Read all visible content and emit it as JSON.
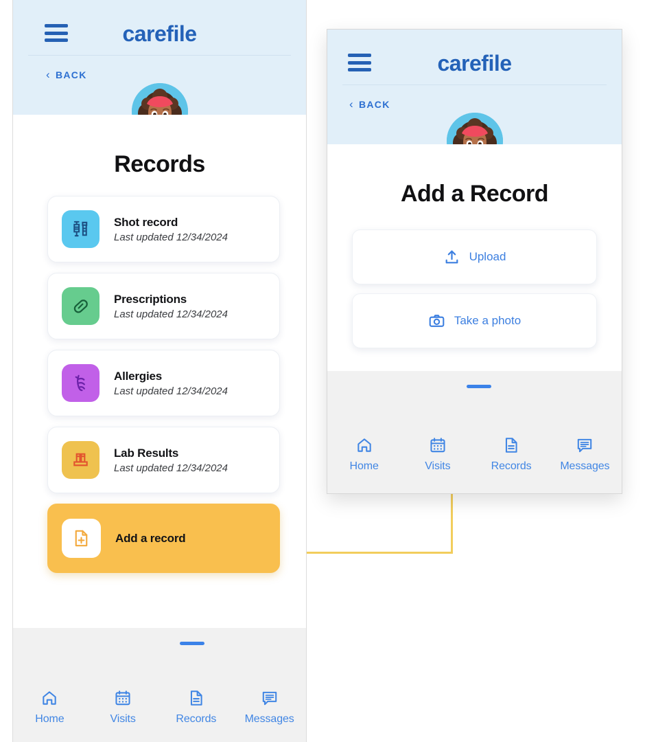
{
  "brand": {
    "name": "carefile"
  },
  "colors": {
    "brand_blue": "#2462b8",
    "header_bg": "#e1eff9",
    "nav_blue": "#4186e4",
    "highlight_yellow": "#f9bf4e",
    "connector_yellow": "#f2cd5c",
    "avatar_circle": "#5ec4e8",
    "badge_green": "#21c24a"
  },
  "screen_records": {
    "menu_icon": "hamburger-menu-icon",
    "back_label": "BACK",
    "back_icon": "chevron-left-icon",
    "avatar": "user-avatar",
    "avatar_badge_icon": "edit-pencil-icon",
    "title": "Records",
    "items": [
      {
        "title": "Shot record",
        "subtitle": "Last updated 12/34/2024",
        "icon": "syringe-icon",
        "tile_color": "#5ac8ef",
        "icon_color": "#1c4f82"
      },
      {
        "title": "Prescriptions",
        "subtitle": "Last updated 12/34/2024",
        "icon": "pill-icon",
        "tile_color": "#66cc8e",
        "icon_color": "#17603a"
      },
      {
        "title": "Allergies",
        "subtitle": "Last updated 12/34/2024",
        "icon": "allergen-icon",
        "tile_color": "#c160e8",
        "icon_color": "#6b21a8"
      },
      {
        "title": "Lab Results",
        "subtitle": "Last updated 12/34/2024",
        "icon": "test-tubes-icon",
        "tile_color": "#efc martial",
        "icon_color": "#e2552f"
      }
    ],
    "add_item": {
      "title": "Add a record",
      "icon": "add-document-icon",
      "tile_color": "#ffffff",
      "icon_color": "#f3a93c"
    },
    "nav": [
      {
        "label": "Home",
        "icon": "home-icon",
        "active": false
      },
      {
        "label": "Visits",
        "icon": "calendar-icon",
        "active": false
      },
      {
        "label": "Records",
        "icon": "document-icon",
        "active": true
      },
      {
        "label": "Messages",
        "icon": "chat-icon",
        "active": false
      }
    ]
  },
  "screen_add_record": {
    "menu_icon": "hamburger-menu-icon",
    "back_label": "BACK",
    "back_icon": "chevron-left-icon",
    "avatar": "user-avatar",
    "avatar_badge_icon": "edit-pencil-icon",
    "title": "Add a Record",
    "actions": [
      {
        "label": "Upload",
        "icon": "upload-icon"
      },
      {
        "label": "Take a photo",
        "icon": "camera-icon"
      }
    ],
    "nav": [
      {
        "label": "Home",
        "icon": "home-icon",
        "active": false
      },
      {
        "label": "Visits",
        "icon": "calendar-icon",
        "active": false
      },
      {
        "label": "Records",
        "icon": "document-icon",
        "active": true
      },
      {
        "label": "Messages",
        "icon": "chat-icon",
        "active": false
      }
    ]
  }
}
